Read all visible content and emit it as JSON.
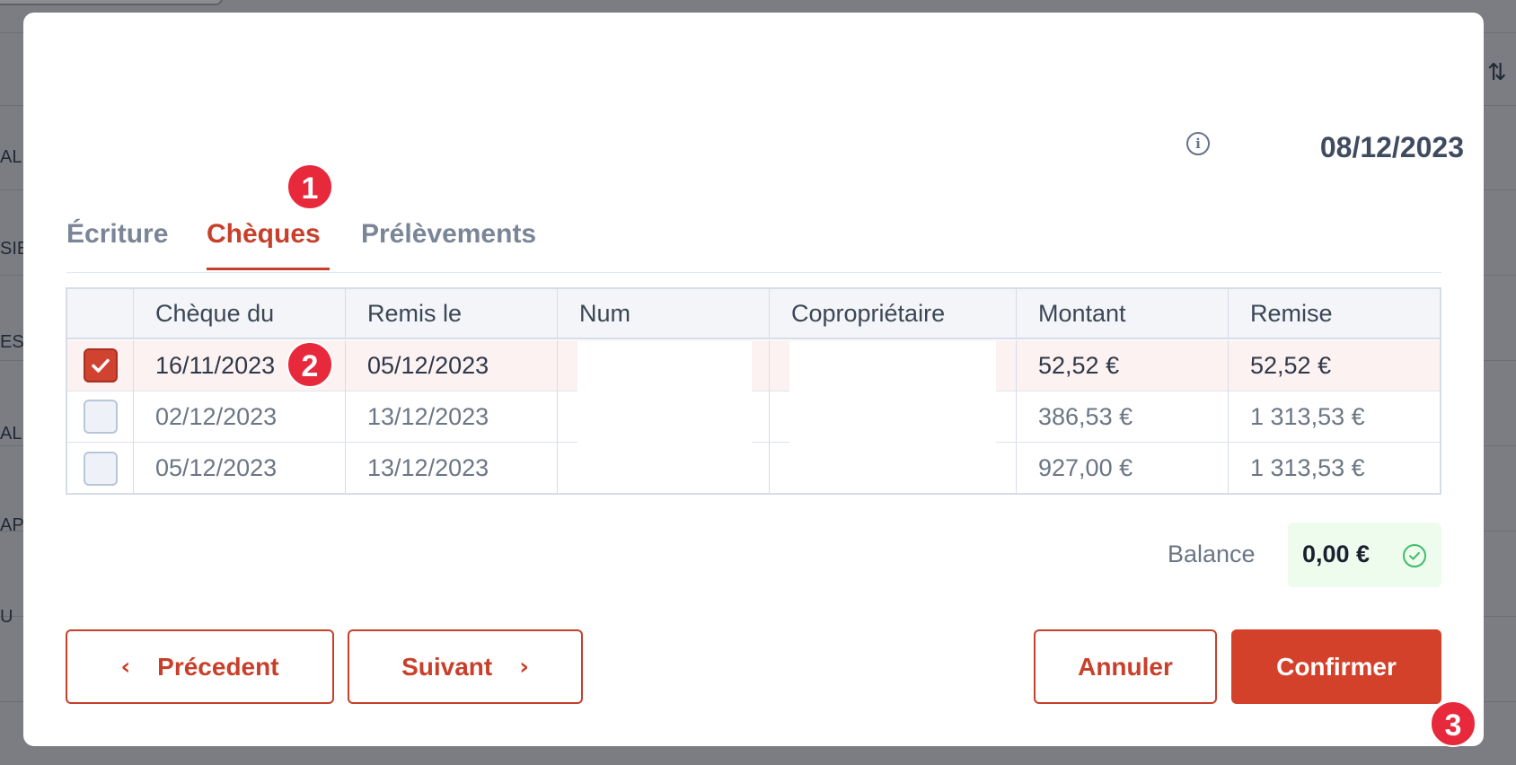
{
  "background": {
    "row_labels": [
      "AL",
      "SIE",
      "ES",
      "AL",
      "AP",
      "U"
    ],
    "sort_icon": "sort-arrows-icon"
  },
  "modal": {
    "date": "08/12/2023",
    "info_icon": "info-icon"
  },
  "tabs": [
    {
      "label": "Écriture",
      "active": false
    },
    {
      "label": "Chèques",
      "active": true
    },
    {
      "label": "Prélèvements",
      "active": false
    }
  ],
  "badges": [
    "1",
    "2",
    "3"
  ],
  "table": {
    "columns": [
      "Chèque du",
      "Remis le",
      "Num",
      "Copropriétaire",
      "Montant",
      "Remise"
    ],
    "rows": [
      {
        "checked": true,
        "cheque_du": "16/11/2023",
        "remis_le": "05/12/2023",
        "num": "",
        "coproprietaire": "",
        "montant": "52,52 €",
        "remise": "52,52 €"
      },
      {
        "checked": false,
        "cheque_du": "02/12/2023",
        "remis_le": "13/12/2023",
        "num": "",
        "coproprietaire": "",
        "montant": "386,53 €",
        "remise": "1 313,53 €"
      },
      {
        "checked": false,
        "cheque_du": "05/12/2023",
        "remis_le": "13/12/2023",
        "num": "",
        "coproprietaire": "",
        "montant": "927,00 €",
        "remise": "1 313,53 €"
      }
    ]
  },
  "balance": {
    "label": "Balance",
    "value": "0,00 €",
    "status_icon": "check-circle-icon",
    "status_color": "#3ebd6a"
  },
  "buttons": {
    "previous": "Précedent",
    "next": "Suivant",
    "cancel": "Annuler",
    "confirm": "Confirmer"
  },
  "colors": {
    "accent": "#c83f2a",
    "badge": "#e8293c",
    "overlay": "#7b7d82"
  }
}
